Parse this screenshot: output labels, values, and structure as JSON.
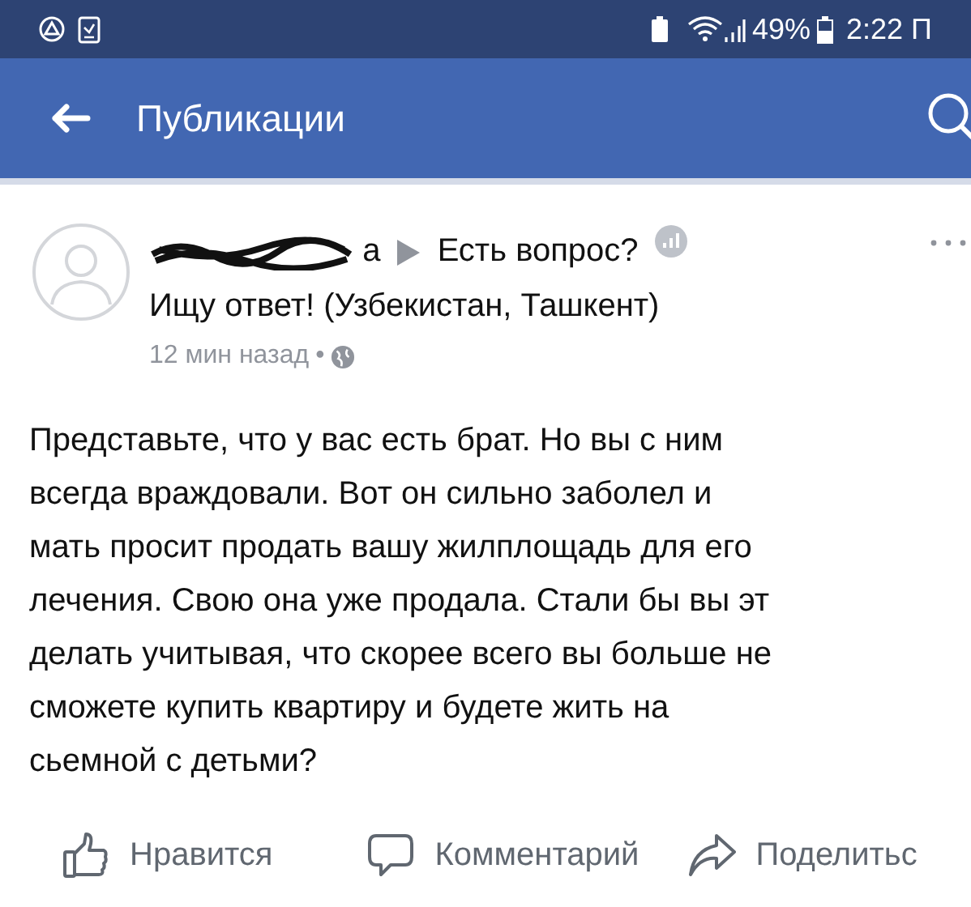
{
  "status_bar": {
    "battery": "49%",
    "time": "2:22 П"
  },
  "toolbar": {
    "title": "Публикации"
  },
  "post": {
    "author_visible": "а",
    "group_lines": [
      "Есть вопрос?",
      "Ищу ответ! (Узбекистан, Ташкент)"
    ],
    "time": "12 мин назад",
    "separator": "•",
    "body": "Представьте, что у вас есть брат. Но вы с ним\nвсегда враждовали. Вот он сильно заболел и\nмать просит продать вашу жилплощадь для его\nлечения. Свою она уже продала. Стали бы вы эт\nделать учитывая, что скорее всего вы больше не\nсможете купить квартиру и будете жить на\nсьемной с детьми?"
  },
  "actions": [
    {
      "kind": "like",
      "label": "Нравится"
    },
    {
      "kind": "comment",
      "label": "Комментарий"
    },
    {
      "kind": "share",
      "label": "Поделитьс"
    }
  ]
}
